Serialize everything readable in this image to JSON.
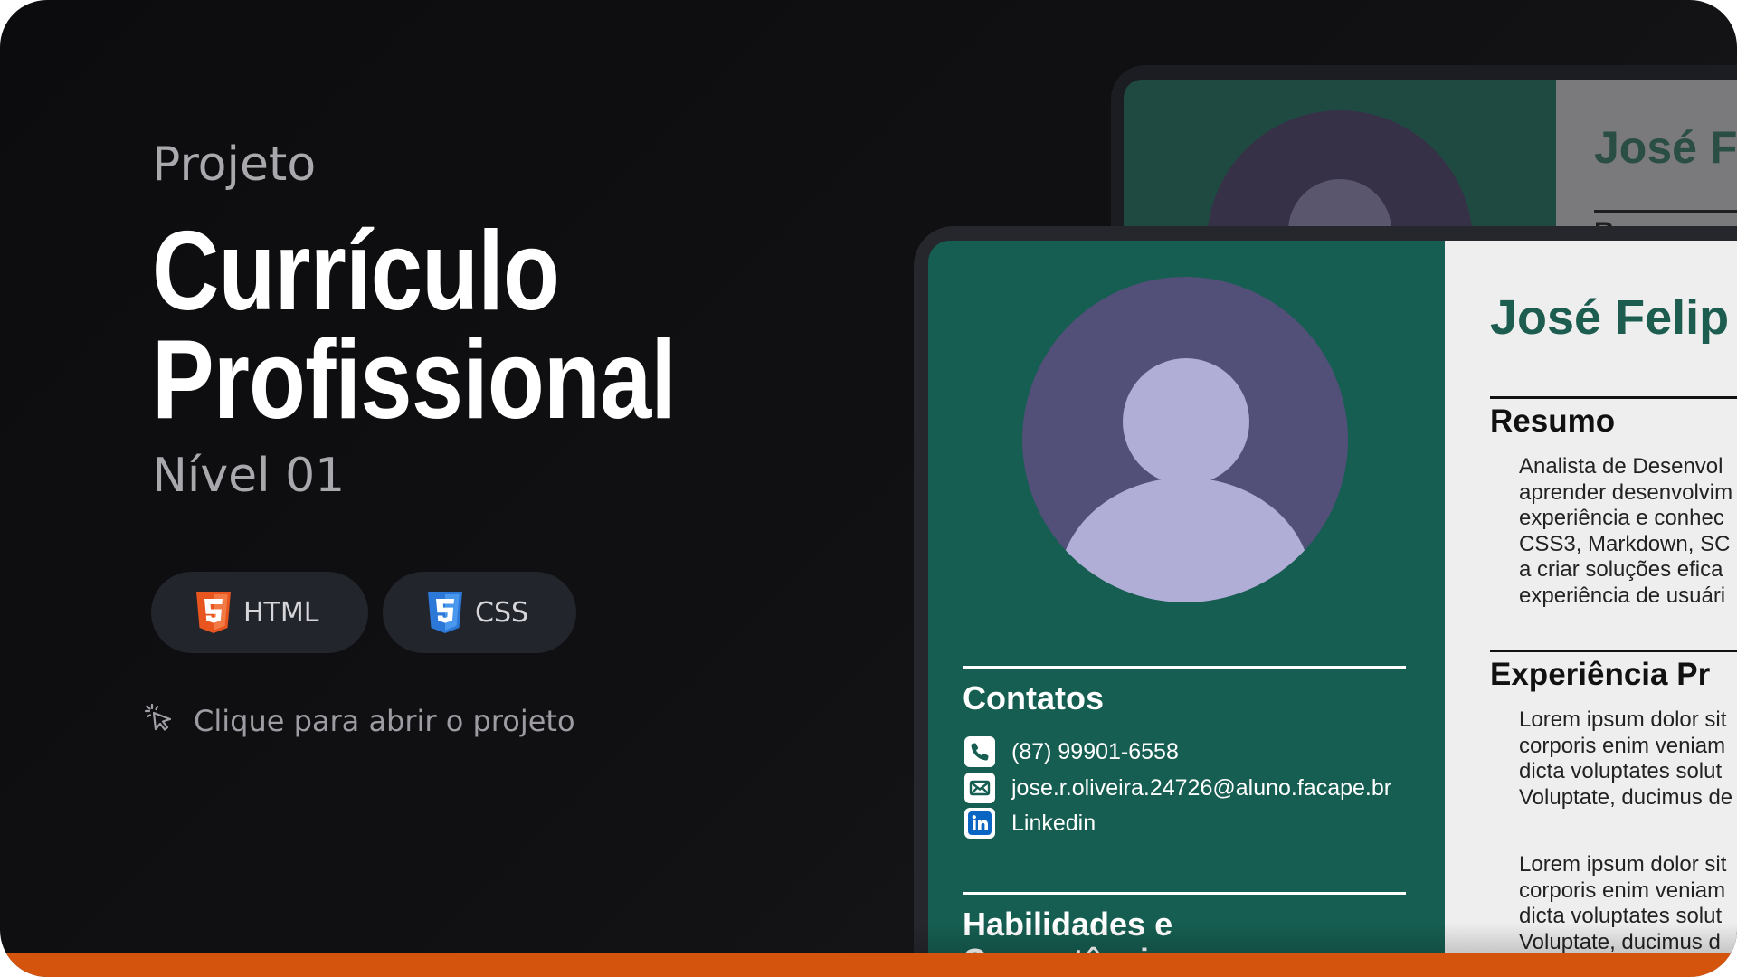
{
  "hero": {
    "subtitle": "Projeto",
    "title_line1": "Currículo",
    "title_line2": "Profissional",
    "level": "Nível 01"
  },
  "tags": [
    {
      "label": "HTML",
      "icon": "html5-icon",
      "color": "#e8551f"
    },
    {
      "label": "CSS",
      "icon": "css3-icon",
      "color": "#2b78d8"
    }
  ],
  "open_hint": {
    "icon": "cursor-click-icon",
    "label": "Clique para abrir o projeto"
  },
  "resume_back": {
    "name": "José Fe",
    "heading": "Resumo"
  },
  "resume": {
    "name": "José Felip",
    "contacts_title": "Contatos",
    "contacts": [
      {
        "icon": "phone-icon",
        "text": "(87) 99901-6558"
      },
      {
        "icon": "mail-icon",
        "text": "jose.r.oliveira.24726@aluno.facape.br"
      },
      {
        "icon": "linkedin-icon",
        "text": "Linkedin"
      }
    ],
    "skills_title_line1": "Habilidades e",
    "skills_title_line2": "Competências",
    "summary_title": "Resumo",
    "summary_lines": [
      "Analista de Desenvol",
      "aprender desenvolvim",
      "experiência e conhec",
      "CSS3, Markdown, SC",
      "a criar soluções efica",
      "experiência de usuári"
    ],
    "experience_title": "Experiência Pr",
    "experience_1_lines": [
      "Lorem ipsum dolor sit",
      "corporis enim veniam",
      "dicta voluptates solut",
      "Voluptate, ducimus de"
    ],
    "experience_2_lines": [
      "Lorem ipsum dolor sit",
      "corporis enim veniam",
      "dicta voluptates solut",
      "Voluptate, ducimus d"
    ]
  },
  "colors": {
    "accent_bar": "#d4540d",
    "resume_sidebar": "#165e51",
    "avatar_bg": "#524f79",
    "avatar_fg": "#b0aed6"
  }
}
